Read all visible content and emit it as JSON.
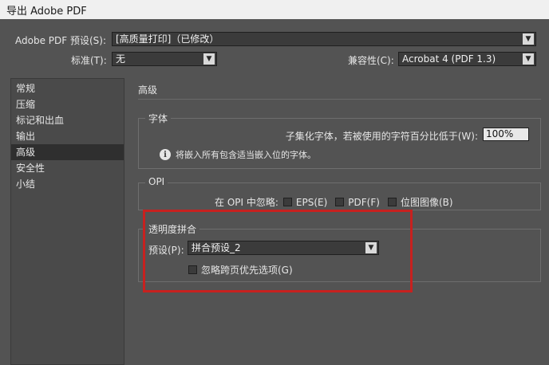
{
  "window": {
    "title": "导出 Adobe PDF"
  },
  "top": {
    "preset_label": "Adobe PDF 预设(S):",
    "preset_value": "[高质量打印]（已修改）",
    "standard_label": "标准(T):",
    "standard_value": "无",
    "compat_label": "兼容性(C):",
    "compat_value": "Acrobat 4 (PDF 1.3)"
  },
  "sidebar": {
    "items": [
      "常规",
      "压缩",
      "标记和出血",
      "输出",
      "高级",
      "安全性",
      "小结"
    ],
    "selected": "高级"
  },
  "main": {
    "section_title": "高级",
    "fonts": {
      "title": "字体",
      "subset_label": "子集化字体，若被使用的字符百分比低于(W):",
      "subset_value": "100%",
      "info_text": "将嵌入所有包含适当嵌入位的字体。"
    },
    "opi": {
      "title": "OPI",
      "omit_label": "在 OPI 中忽略:",
      "eps_label": "EPS(E)",
      "pdf_label": "PDF(F)",
      "bitmap_label": "位图图像(B)"
    },
    "transparency": {
      "title": "透明度拼合",
      "preset_label": "预设(P):",
      "preset_value": "拼合预设_2",
      "ignore_label": "忽略跨页优先选项(G)"
    }
  },
  "colors": {
    "highlight": "#c7211f",
    "background": "#535353"
  },
  "icons": {
    "dropdown": "chevron-down-icon",
    "info": "info-icon"
  }
}
